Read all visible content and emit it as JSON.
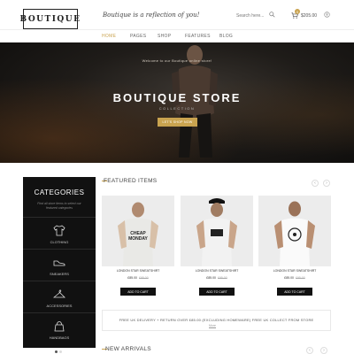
{
  "header": {
    "logo": "BOUTIQUE",
    "tagline": "Boutique is a reflection of you!",
    "search_placeholder": "Search here...",
    "cart_count": "0",
    "cart_total": "$205.00"
  },
  "nav": [
    "HOME",
    "PAGES",
    "SHOP",
    "FEATURES",
    "BLOG"
  ],
  "hero": {
    "small_text": "Welcome to our Boutique online store!",
    "title": "BOUTIQUE STORE",
    "subtitle": "COLLECTION",
    "button": "LET'S SHOP NOW"
  },
  "categories": {
    "title": "CATEGORIES",
    "description": "Find all store items to select our featured categories",
    "items": [
      {
        "label": "CLOTHING",
        "icon": "tshirt-icon"
      },
      {
        "label": "SNEAKERS",
        "icon": "sneaker-icon"
      },
      {
        "label": "ACCESSORIES",
        "icon": "hanger-icon"
      },
      {
        "label": "HANDBAGS",
        "icon": "handbag-icon"
      }
    ]
  },
  "featured": {
    "title": "FEATURED ITEMS",
    "products": [
      {
        "name": "LONDON STAR SWEATSHIRT",
        "price": "£85.00",
        "old_price": "£95.00",
        "button": "ADD TO CART"
      },
      {
        "name": "LONDON STAR SWEATSHIRT",
        "price": "£85.00",
        "old_price": "£95.00",
        "button": "ADD TO CART"
      },
      {
        "name": "LONDON STAR SWEATSHIRT",
        "price": "£85.00",
        "old_price": "£95.00",
        "button": "ADD TO CART"
      }
    ]
  },
  "shipping": {
    "text": "FREE UK DELIVERY + RETURN OVER £85.00 (EXCLUDING HOMEWARE) FREE UK COLLECT FROM STORE",
    "link": "More"
  },
  "arrivals": {
    "title": "NEW ARRIVALS"
  },
  "colors": {
    "accent": "#c9a34f",
    "dark": "#111111"
  }
}
